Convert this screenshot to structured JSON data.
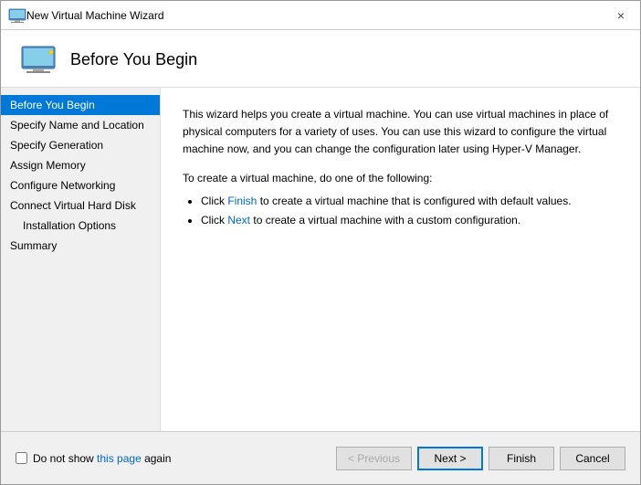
{
  "window": {
    "title": "New Virtual Machine Wizard",
    "close_label": "×"
  },
  "header": {
    "title": "Before You Begin"
  },
  "sidebar": {
    "items": [
      {
        "label": "Before You Begin",
        "active": true,
        "sub": false
      },
      {
        "label": "Specify Name and Location",
        "active": false,
        "sub": false
      },
      {
        "label": "Specify Generation",
        "active": false,
        "sub": false
      },
      {
        "label": "Assign Memory",
        "active": false,
        "sub": false
      },
      {
        "label": "Configure Networking",
        "active": false,
        "sub": false
      },
      {
        "label": "Connect Virtual Hard Disk",
        "active": false,
        "sub": false
      },
      {
        "label": "Installation Options",
        "active": false,
        "sub": true
      },
      {
        "label": "Summary",
        "active": false,
        "sub": false
      }
    ]
  },
  "main": {
    "paragraph1": "This wizard helps you create a virtual machine. You can use virtual machines in place of physical computers for a variety of uses. You can use this wizard to configure the virtual machine now, and you can change the configuration later using Hyper-V Manager.",
    "paragraph2": "To create a virtual machine, do one of the following:",
    "bullets": [
      "Click Finish to create a virtual machine that is configured with default values.",
      "Click Next to create a virtual machine with a custom configuration."
    ]
  },
  "footer": {
    "checkbox_label": "Do not show ",
    "checkbox_link": "this page",
    "checkbox_label2": " again"
  },
  "buttons": {
    "previous": "< Previous",
    "next": "Next >",
    "finish": "Finish",
    "cancel": "Cancel"
  }
}
